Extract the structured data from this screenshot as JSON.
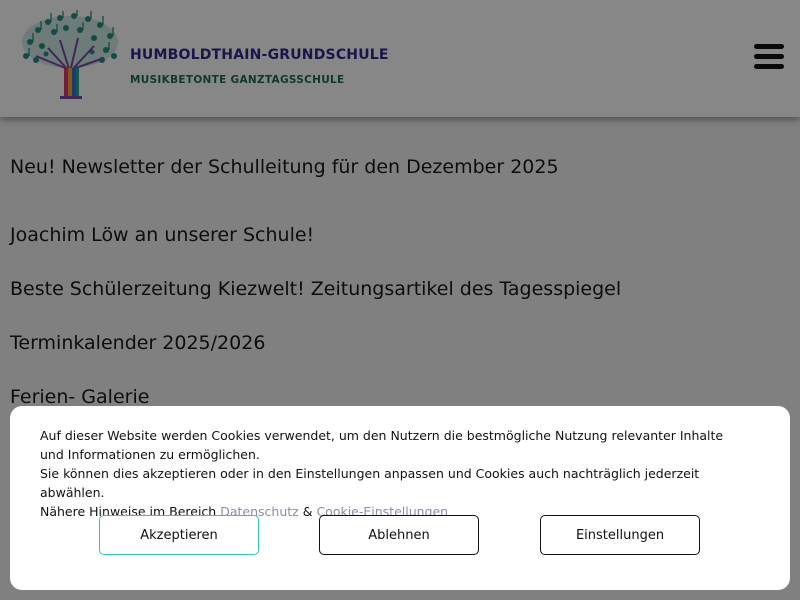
{
  "header": {
    "school_name": "HUMBOLDTHAIN-GRUNDSCHULE",
    "school_subtitle": "MUSIKBETONTE GANZTAGSSCHULE",
    "logo_icon": "music-tree-logo",
    "menu_icon": "hamburger-menu-icon",
    "colors": {
      "name": "#2d2a8e",
      "subtitle": "#1f6b5d"
    }
  },
  "main": {
    "links": [
      "Neu! Newsletter der Schulleitung für den Dezember 2025",
      "Joachim Löw an unserer Schule!",
      "Beste Schülerzeitung Kiezwelt! Zeitungsartikel des Tagesspiegel",
      "Terminkalender 2025/2026",
      "Ferien- Galerie"
    ]
  },
  "cookie_banner": {
    "line1": "Auf dieser Website werden Cookies verwendet, um den Nutzern die bestmögliche Nutzung relevanter Inhalte und Informationen zu ermöglichen.",
    "line2": "Sie können dies akzeptieren oder in den Einstellungen anpassen und Cookies auch nachträglich jederzeit abwählen.",
    "line3_prefix": "Nähere Hinweise im Bereich",
    "privacy_link": "Datenschutz",
    "amp": "&",
    "cookie_settings_link": "Cookie-Einstellungen",
    "accept_label": "Akzeptieren",
    "reject_label": "Ablehnen",
    "settings_label": "Einstellungen",
    "colors": {
      "accept_border": "#32c4bf",
      "link": "#8a8fa8"
    }
  }
}
